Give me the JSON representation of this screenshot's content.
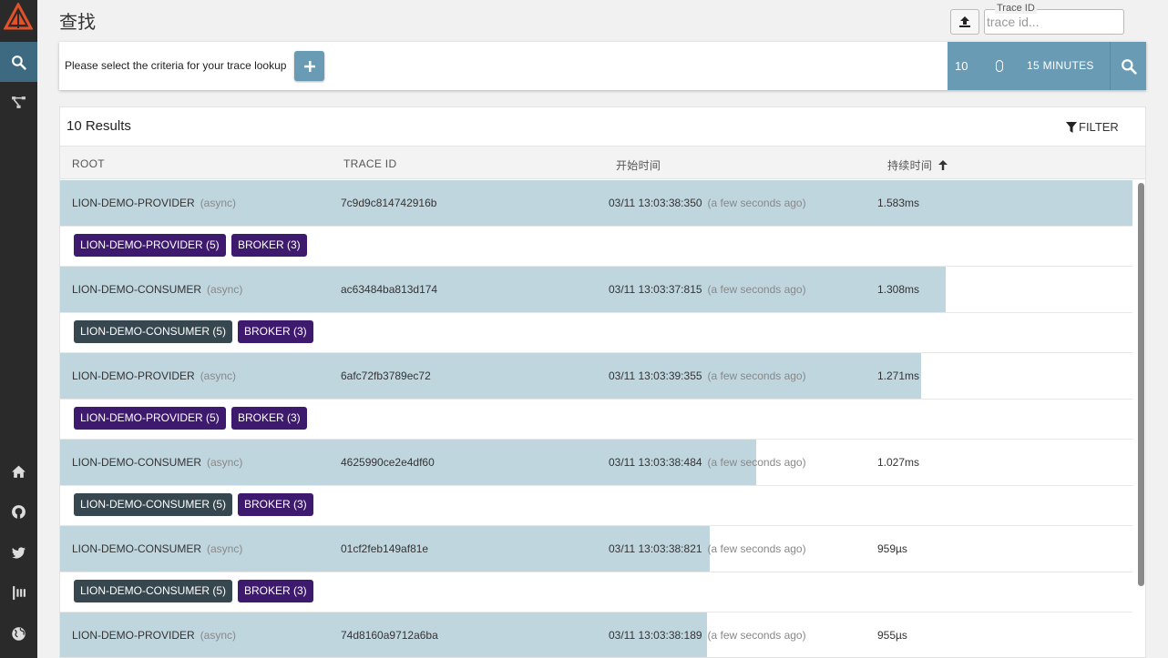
{
  "page": {
    "title": "查找"
  },
  "header": {
    "trace_id_label": "Trace ID",
    "trace_id_placeholder": "trace id..."
  },
  "sidebar": {
    "items": [
      {
        "name": "search",
        "icon": "search-icon",
        "active": true
      },
      {
        "name": "dependencies",
        "icon": "dependencies-icon",
        "active": false
      },
      {
        "name": "home",
        "icon": "home-icon",
        "active": false
      },
      {
        "name": "github",
        "icon": "github-icon",
        "active": false
      },
      {
        "name": "twitter",
        "icon": "twitter-icon",
        "active": false
      },
      {
        "name": "gitter",
        "icon": "gitter-icon",
        "active": false
      },
      {
        "name": "website",
        "icon": "globe-icon",
        "active": false
      }
    ]
  },
  "search": {
    "criteria_prompt": "Please select the criteria for your trace lookup",
    "limit": "10",
    "lookback": "15 MINUTES"
  },
  "results": {
    "count_label": "10 Results",
    "filter_label": "FILTER",
    "columns": {
      "root": "ROOT",
      "trace_id": "TRACE ID",
      "start_time": "开始时间",
      "duration": "持续时间"
    },
    "async_label": "(async)",
    "rows": [
      {
        "root": "LION-DEMO-PROVIDER",
        "trace_id": "7c9d9c814742916b",
        "start": "03/11 13:03:38:350",
        "ago": "(a few seconds ago)",
        "duration": "1.583ms",
        "bar_fraction": 1.0,
        "tags": [
          {
            "label": "LION-DEMO-PROVIDER (5)",
            "kind": "provider"
          },
          {
            "label": "BROKER (3)",
            "kind": "broker"
          }
        ]
      },
      {
        "root": "LION-DEMO-CONSUMER",
        "trace_id": "ac63484ba813d174",
        "start": "03/11 13:03:37:815",
        "ago": "(a few seconds ago)",
        "duration": "1.308ms",
        "bar_fraction": 0.826,
        "tags": [
          {
            "label": "LION-DEMO-CONSUMER (5)",
            "kind": "consumer"
          },
          {
            "label": "BROKER (3)",
            "kind": "broker"
          }
        ]
      },
      {
        "root": "LION-DEMO-PROVIDER",
        "trace_id": "6afc72fb3789ec72",
        "start": "03/11 13:03:39:355",
        "ago": "(a few seconds ago)",
        "duration": "1.271ms",
        "bar_fraction": 0.803,
        "tags": [
          {
            "label": "LION-DEMO-PROVIDER (5)",
            "kind": "provider"
          },
          {
            "label": "BROKER (3)",
            "kind": "broker"
          }
        ]
      },
      {
        "root": "LION-DEMO-CONSUMER",
        "trace_id": "4625990ce2e4df60",
        "start": "03/11 13:03:38:484",
        "ago": "(a few seconds ago)",
        "duration": "1.027ms",
        "bar_fraction": 0.649,
        "tags": [
          {
            "label": "LION-DEMO-CONSUMER (5)",
            "kind": "consumer"
          },
          {
            "label": "BROKER (3)",
            "kind": "broker"
          }
        ]
      },
      {
        "root": "LION-DEMO-CONSUMER",
        "trace_id": "01cf2feb149af81e",
        "start": "03/11 13:03:38:821",
        "ago": "(a few seconds ago)",
        "duration": "959µs",
        "bar_fraction": 0.606,
        "tags": [
          {
            "label": "LION-DEMO-CONSUMER (5)",
            "kind": "consumer"
          },
          {
            "label": "BROKER (3)",
            "kind": "broker"
          }
        ]
      },
      {
        "root": "LION-DEMO-PROVIDER",
        "trace_id": "74d8160a9712a6ba",
        "start": "03/11 13:03:38:189",
        "ago": "(a few seconds ago)",
        "duration": "955µs",
        "bar_fraction": 0.603,
        "tags": []
      }
    ]
  },
  "colors": {
    "sidebar_bg": "#2a2a2a",
    "accent": "#6a9bb5",
    "trace_bar": "#c0d6df",
    "provider_tag": "#3e1a6e",
    "consumer_tag": "#37474f"
  }
}
